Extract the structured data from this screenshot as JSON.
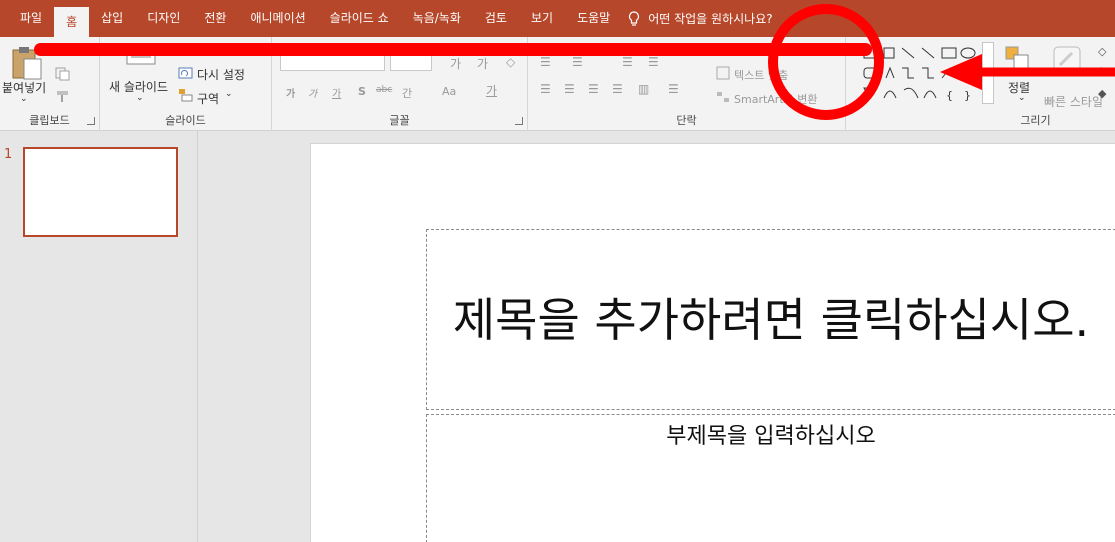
{
  "tabs": [
    {
      "label": "파일",
      "active": false
    },
    {
      "label": "홈",
      "active": true
    },
    {
      "label": "삽입",
      "active": false
    },
    {
      "label": "디자인",
      "active": false
    },
    {
      "label": "전환",
      "active": false
    },
    {
      "label": "애니메이션",
      "active": false
    },
    {
      "label": "슬라이드 쇼",
      "active": false
    },
    {
      "label": "녹음/녹화",
      "active": false
    },
    {
      "label": "검토",
      "active": false
    },
    {
      "label": "보기",
      "active": false
    },
    {
      "label": "도움말",
      "active": false
    }
  ],
  "tell_me": "어떤 작업을 원하시나요?",
  "ribbon": {
    "clipboard": {
      "label": "클립보드",
      "paste": "붙여넣기"
    },
    "slides": {
      "label": "슬라이드",
      "new_slide": "새 슬라이드",
      "reset": "다시 설정",
      "section": "구역"
    },
    "font": {
      "label": "글꼴",
      "buttons": [
        "가",
        "가",
        "가",
        "S",
        "abc",
        "간",
        "Aa",
        "가"
      ]
    },
    "paragraph": {
      "label": "단락",
      "text_align": "텍스트 맞춤",
      "smartart": "SmartArt로 변환"
    },
    "drawing": {
      "label": "그리기",
      "arrange": "정렬",
      "quick_styles": "빠른 스타일"
    }
  },
  "slide_pane": {
    "slide_number": "1"
  },
  "slide": {
    "title_placeholder": "제목을 추가하려면 클릭하십시오.",
    "subtitle_placeholder": "부제목을 입력하십시오"
  },
  "colors": {
    "accent": "#b7472a",
    "annotation": "#ff0000",
    "ribbon": "#f3f3f3"
  }
}
